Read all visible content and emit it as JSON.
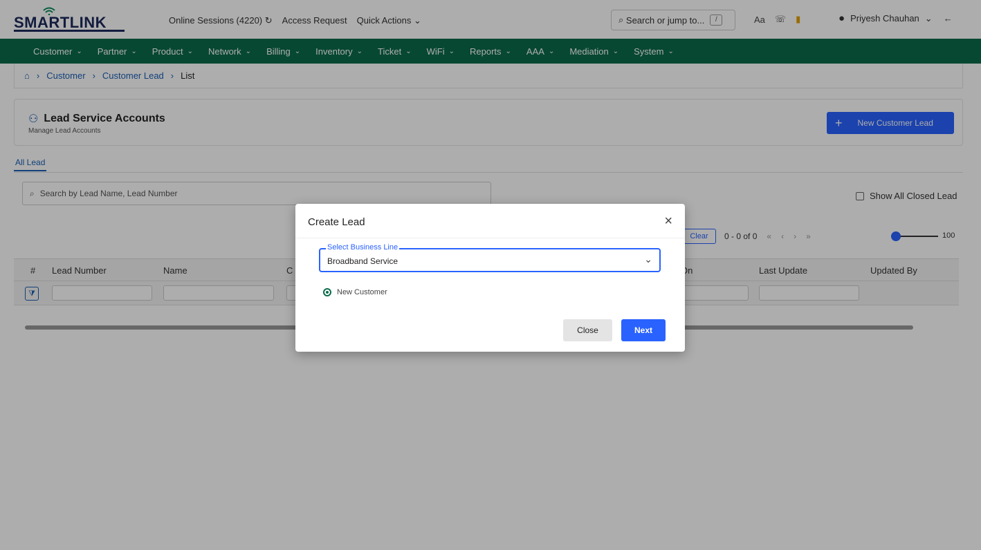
{
  "app": {
    "brand": "SMARTLINK",
    "top_links": {
      "online_sessions": "Online Sessions (4220)",
      "access_request": "Access Request",
      "quick_actions": "Quick Actions"
    },
    "search_jump": {
      "placeholder": "Search or jump to...",
      "shortcut": "/"
    },
    "font_toggle": "Aa",
    "user_name": "Priyesh Chauhan"
  },
  "nav": {
    "items": [
      {
        "label": "Customer"
      },
      {
        "label": "Partner"
      },
      {
        "label": "Product"
      },
      {
        "label": "Network"
      },
      {
        "label": "Billing"
      },
      {
        "label": "Inventory"
      },
      {
        "label": "Ticket"
      },
      {
        "label": "WiFi"
      },
      {
        "label": "Reports"
      },
      {
        "label": "AAA"
      },
      {
        "label": "Mediation"
      },
      {
        "label": "System"
      }
    ]
  },
  "breadcrumb": {
    "items": [
      "Customer",
      "Customer Lead",
      "List"
    ]
  },
  "header": {
    "title": "Lead Service Accounts",
    "subtitle": "Manage Lead Accounts",
    "new_button": "New Customer Lead"
  },
  "tabs": {
    "active": "All Lead"
  },
  "search": {
    "placeholder": "Search by Lead Name, Lead Number"
  },
  "closed_toggle": {
    "label": "Show All Closed Lead",
    "checked": false
  },
  "pagination": {
    "clear_label": "Clear",
    "range": "0 - 0 of 0",
    "page_size": "100"
  },
  "table": {
    "columns": [
      "#",
      "Lead Number",
      "Name",
      "C",
      "On",
      "Last Update",
      "Updated By"
    ]
  },
  "modal": {
    "title": "Create Lead",
    "field_label": "Select Business Line",
    "field_value": "Broadband Service",
    "radio_label": "New Customer",
    "close_label": "Close",
    "next_label": "Next"
  },
  "colors": {
    "nav_bg": "#0b6b4a",
    "accent": "#2962ff",
    "brand": "#1d2a5c"
  }
}
